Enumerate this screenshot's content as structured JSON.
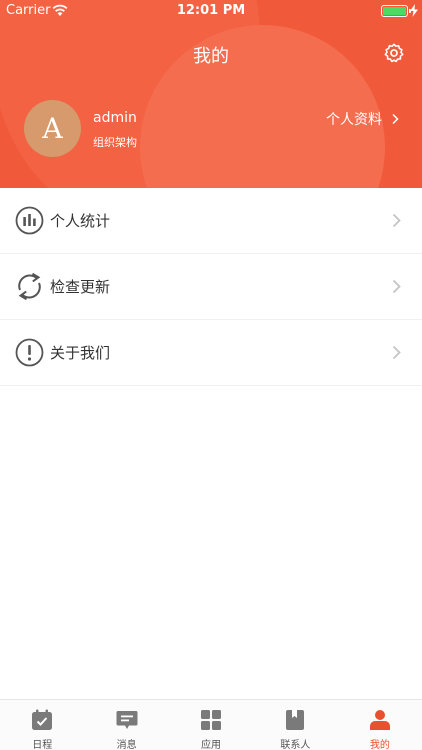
{
  "status_bar": {
    "carrier": "Carrier",
    "time": "12:01 PM"
  },
  "nav": {
    "title": "我的"
  },
  "profile": {
    "avatar_letter": "A",
    "username": "admin",
    "org": "组织架构",
    "profile_link": "个人资料"
  },
  "menu": {
    "items": [
      {
        "label": "个人统计",
        "icon": "bar-chart-icon"
      },
      {
        "label": "检查更新",
        "icon": "refresh-icon"
      },
      {
        "label": "关于我们",
        "icon": "info-icon"
      }
    ]
  },
  "tabbar": {
    "tabs": [
      {
        "label": "日程",
        "icon": "calendar-check-icon"
      },
      {
        "label": "消息",
        "icon": "message-icon"
      },
      {
        "label": "应用",
        "icon": "grid-icon"
      },
      {
        "label": "联系人",
        "icon": "contacts-book-icon"
      },
      {
        "label": "我的",
        "icon": "person-icon"
      }
    ],
    "active_index": 4
  },
  "colors": {
    "header": "#f05a3a",
    "accent": "#e8512f",
    "inactive_icon": "#7a7a7a",
    "avatar_bg": "#d69a6c"
  }
}
